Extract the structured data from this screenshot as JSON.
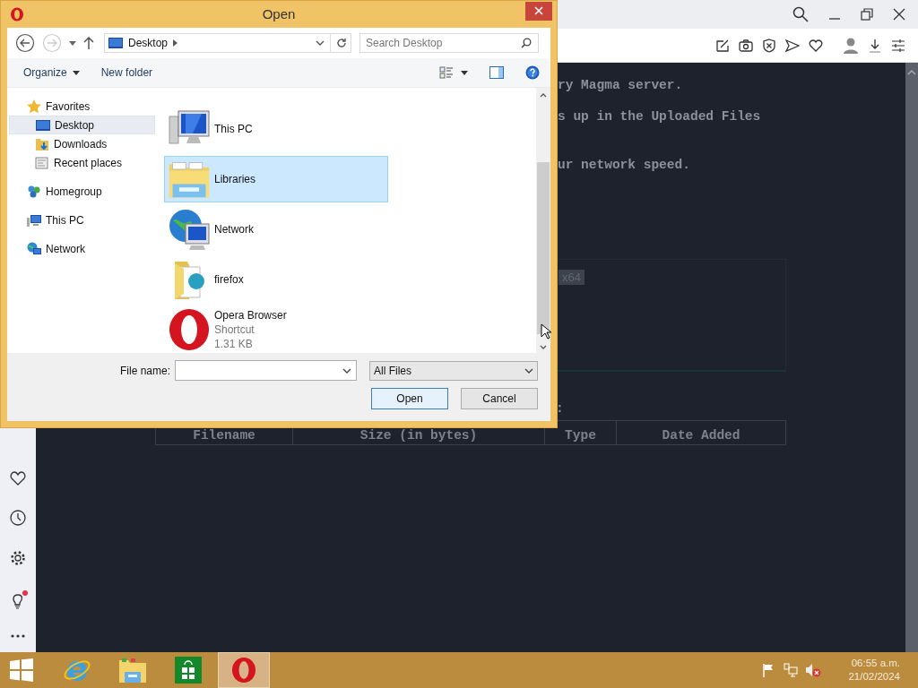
{
  "browser": {
    "page": {
      "lines": [
        "ry Magma server.",
        "s up in the Uploaded Files",
        "ur network speed."
      ],
      "badge": "x64",
      "colon": ":",
      "table": {
        "columns": [
          "Filename",
          "Size (in bytes)",
          "Type",
          "Date Added"
        ]
      }
    },
    "sidebar": [
      {
        "kind": "heart"
      },
      {
        "kind": "clock"
      },
      {
        "kind": "gear"
      },
      {
        "kind": "bulb",
        "alert": true
      },
      {
        "kind": "more"
      }
    ]
  },
  "dialog": {
    "title": "Open",
    "address": "Desktop",
    "search": {
      "placeholder": "Search Desktop"
    },
    "commands": [
      "Organize",
      "New folder"
    ],
    "nav": [
      {
        "label": "Favorites",
        "kind": "star",
        "selected": false,
        "children": [
          {
            "label": "Desktop",
            "kind": "desktop",
            "selected": true
          },
          {
            "label": "Downloads",
            "kind": "downloads",
            "selected": false
          },
          {
            "label": "Recent places",
            "kind": "recent",
            "selected": false
          }
        ]
      },
      {
        "label": "Homegroup",
        "kind": "homegroup",
        "selected": false
      },
      {
        "label": "This PC",
        "kind": "pc",
        "selected": false
      },
      {
        "label": "Network",
        "kind": "network",
        "selected": false
      }
    ],
    "files": [
      {
        "name": "This PC",
        "kind": "computer",
        "selected": false
      },
      {
        "name": "Libraries",
        "kind": "library",
        "selected": true
      },
      {
        "name": "Network",
        "kind": "network",
        "selected": false
      },
      {
        "name": "firefox",
        "kind": "folder",
        "selected": false
      },
      {
        "name": "Opera Browser",
        "kind": "opera",
        "selected": false,
        "details": [
          "Shortcut",
          "1.31 KB"
        ]
      }
    ],
    "file_name_label": "File name:",
    "file_type": "All Files",
    "buttons": [
      "Open",
      "Cancel"
    ]
  },
  "taskbar": {
    "apps": [
      {
        "kind": "ie",
        "selected": false
      },
      {
        "kind": "explorer",
        "selected": false
      },
      {
        "kind": "store",
        "selected": false
      },
      {
        "kind": "opera",
        "selected": true
      }
    ],
    "time": "06:55 a.m.",
    "date": "21/02/2024"
  }
}
